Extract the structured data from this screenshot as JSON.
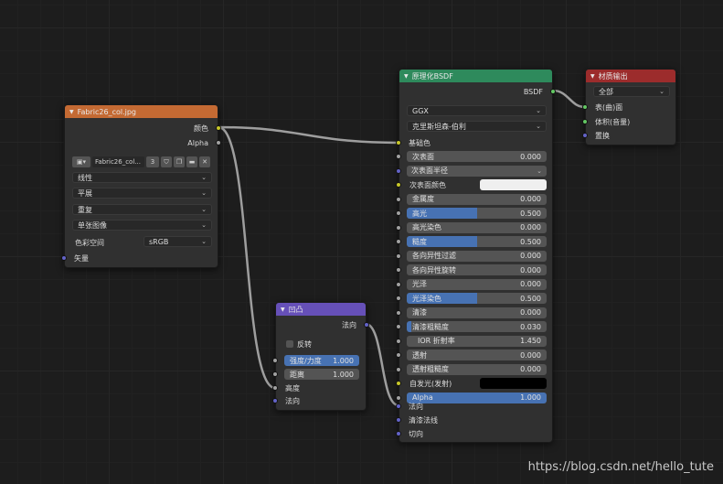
{
  "colors": {
    "texture_header": "#c46a33",
    "bump_header": "#6650b8",
    "bsdf_header": "#2e8a5c",
    "output_header": "#9c2c2c",
    "slider_fill": "#4772b3",
    "link_wire": "#9e9e9e"
  },
  "image_texture": {
    "title": "Fabric26_col.jpg",
    "out_color": "颜色",
    "out_alpha": "Alpha",
    "image_name": "Fabric26_col...",
    "user_count": "3",
    "icons": [
      "image-icon",
      "shield-icon",
      "duplicate-icon",
      "folder-icon",
      "close-icon"
    ],
    "interpolation": "线性",
    "projection": "平展",
    "extension": "重复",
    "source": "单张图像",
    "colorspace_label": "色彩空间",
    "colorspace_value": "sRGB",
    "in_vector": "矢量"
  },
  "bump": {
    "title": "凹凸",
    "out_normal": "法向",
    "invert_label": "反转",
    "invert_checked": false,
    "strength_label": "强度/力度",
    "strength_value": "1.000",
    "distance_label": "距离",
    "distance_value": "1.000",
    "in_height": "高度",
    "in_normal": "法向"
  },
  "bsdf": {
    "title": "原理化BSDF",
    "out_bsdf": "BSDF",
    "distribution": "GGX",
    "subsurface_method": "克里斯坦森-伯利",
    "base_color_label": "基础色",
    "rows": [
      {
        "label": "次表面",
        "value": "0.000",
        "fill": 0
      },
      {
        "label": "次表面半径",
        "value": "",
        "fill": 0,
        "dropdown": true
      },
      {
        "label": "次表面颜色",
        "value": "",
        "swatch": "#efefef"
      },
      {
        "label": "金属度",
        "value": "0.000",
        "fill": 0
      },
      {
        "label": "高光",
        "value": "0.500",
        "fill": 0.5
      },
      {
        "label": "高光染色",
        "value": "0.000",
        "fill": 0
      },
      {
        "label": "糙度",
        "value": "0.500",
        "fill": 0.5
      },
      {
        "label": "各向异性过滤",
        "value": "0.000",
        "fill": 0
      },
      {
        "label": "各向异性旋转",
        "value": "0.000",
        "fill": 0
      },
      {
        "label": "光泽",
        "value": "0.000",
        "fill": 0
      },
      {
        "label": "光泽染色",
        "value": "0.500",
        "fill": 0.5
      },
      {
        "label": "清漆",
        "value": "0.000",
        "fill": 0
      },
      {
        "label": "清漆粗糙度",
        "value": "0.030",
        "fill": 0.03
      },
      {
        "label": "IOR 折射率",
        "value": "1.450",
        "fill": 0,
        "centered": true
      },
      {
        "label": "透射",
        "value": "0.000",
        "fill": 0
      },
      {
        "label": "透射粗糙度",
        "value": "0.000",
        "fill": 0
      },
      {
        "label": "自发光(发射)",
        "value": "",
        "swatch": "#000000"
      },
      {
        "label": "Alpha",
        "value": "1.000",
        "fill": 1
      }
    ],
    "in_normal": "法向",
    "in_clearcoat_normal": "清漆法线",
    "in_tangent": "切向"
  },
  "output": {
    "title": "材质输出",
    "target": "全部",
    "in_surface": "表(曲)面",
    "in_volume": "体积(音量)",
    "in_displacement": "置换"
  },
  "watermark": "https://blog.csdn.net/hello_tute"
}
